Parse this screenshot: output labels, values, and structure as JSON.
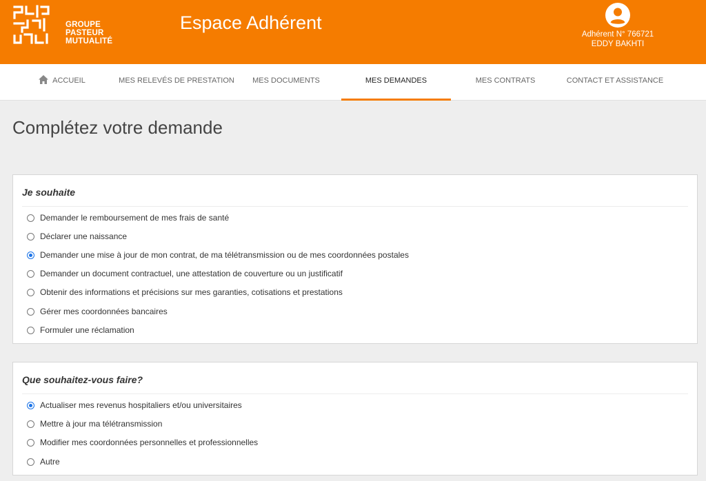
{
  "header": {
    "logo_lines": [
      "GROUPE",
      "PASTEUR",
      "MUTUALITÉ"
    ],
    "app_title": "Espace Adhérent",
    "user_number": "Adhérent N° 766721",
    "user_name": "EDDY BAKHTI"
  },
  "nav": {
    "items": [
      {
        "label": "ACCUEIL",
        "icon": "home-icon"
      },
      {
        "label": "MES RELEVÉS DE PRESTATION"
      },
      {
        "label": "MES DOCUMENTS"
      },
      {
        "label": "MES DEMANDES",
        "active": true
      },
      {
        "label": "MES CONTRATS"
      },
      {
        "label": "CONTACT ET ASSISTANCE"
      }
    ]
  },
  "page": {
    "title": "Complétez votre demande"
  },
  "section1": {
    "title": "Je souhaite",
    "options": [
      "Demander le remboursement de mes frais de santé",
      "Déclarer une naissance",
      "Demander une mise à jour de mon contrat, de ma télétransmission ou de mes coordonnées postales",
      "Demander un document contractuel, une attestation de couverture ou un justificatif",
      "Obtenir des informations et précisions sur mes garanties, cotisations et prestations",
      "Gérer mes coordonnées bancaires",
      "Formuler une réclamation"
    ],
    "selected_index": 2
  },
  "section2": {
    "title": "Que souhaitez-vous faire?",
    "options": [
      "Actualiser mes revenus hospitaliers et/ou universitaires",
      "Mettre à jour ma télétransmission",
      "Modifier mes coordonnées personnelles et professionnelles",
      "Autre"
    ],
    "selected_index": 0
  },
  "colors": {
    "brand": "#f57c00",
    "radio_checked": "#1a73e8"
  }
}
